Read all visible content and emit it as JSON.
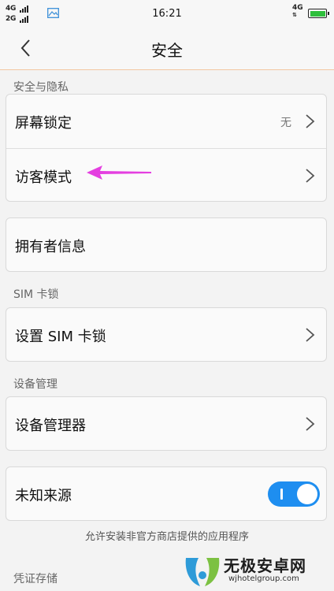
{
  "status_bar": {
    "signal_1": "4G",
    "signal_2": "2G",
    "time": "16:21",
    "network": "4G",
    "battery_level": 1.0,
    "battery_color": "#2fbf3c"
  },
  "header": {
    "title": "安全",
    "back_icon": "chevron-left-icon",
    "accent_line_color": "#f2c7a1"
  },
  "sections": {
    "security_privacy": {
      "header": "安全与隐私",
      "screen_lock_label": "屏幕锁定",
      "screen_lock_value": "无",
      "guest_mode_label": "访客模式"
    },
    "owner_info_label": "拥有者信息",
    "sim_lock": {
      "header": "SIM 卡锁",
      "setup_label": "设置 SIM 卡锁"
    },
    "device_management": {
      "header": "设备管理",
      "manager_label": "设备管理器"
    },
    "unknown_sources": {
      "label": "未知来源",
      "enabled": true,
      "toggle_color": "#1e8ef0",
      "note": "允许安装非官方商店提供的应用程序"
    },
    "credential_storage": {
      "header": "凭证存储"
    }
  },
  "annotation": {
    "arrow_color": "#e43fe0"
  },
  "watermark": {
    "text": "无极安卓网",
    "url": "wjhotelgroup.com",
    "logo_colors": [
      "#2e9bd8",
      "#7cc142"
    ]
  }
}
